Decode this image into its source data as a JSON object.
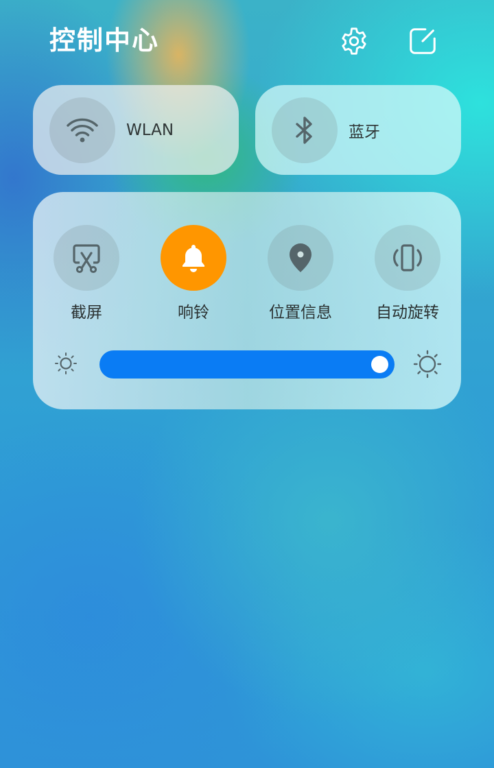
{
  "header": {
    "title": "控制中心",
    "settings_icon": "gear-icon",
    "edit_icon": "edit-icon"
  },
  "tiles": [
    {
      "label": "WLAN",
      "icon": "wifi-icon"
    },
    {
      "label": "蓝牙",
      "icon": "bluetooth-icon"
    }
  ],
  "toggles": [
    {
      "label": "截屏",
      "icon": "screenshot-icon",
      "active": false
    },
    {
      "label": "响铃",
      "icon": "bell-icon",
      "active": true
    },
    {
      "label": "位置信息",
      "icon": "location-pin-icon",
      "active": false
    },
    {
      "label": "自动旋转",
      "icon": "auto-rotate-icon",
      "active": false
    }
  ],
  "brightness": {
    "level": 0.95,
    "low_icon": "brightness-low-icon",
    "high_icon": "brightness-high-icon"
  },
  "colors": {
    "accent": "#0a7cf4",
    "active_toggle": "#ff9600",
    "icon_gray": "#55656a"
  }
}
